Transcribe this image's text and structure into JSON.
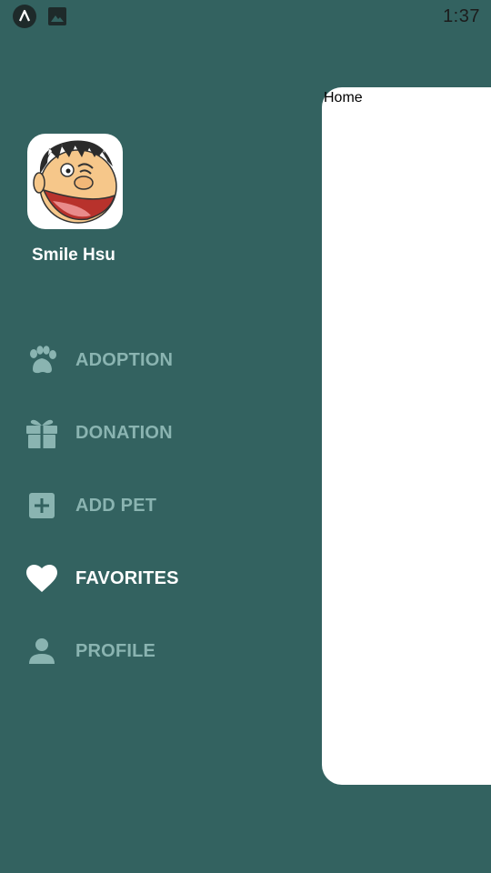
{
  "status_bar": {
    "time": "1:37",
    "icons": [
      "app-notification-icon",
      "image-notification-icon"
    ]
  },
  "drawer": {
    "user": {
      "name": "Smile Hsu",
      "avatar_icon": "cartoon-avatar"
    },
    "items": [
      {
        "label": "ADOPTION",
        "icon": "paw-icon",
        "active": false
      },
      {
        "label": "DONATION",
        "icon": "gift-icon",
        "active": false
      },
      {
        "label": "ADD PET",
        "icon": "add-box-icon",
        "active": false
      },
      {
        "label": "FAVORITES",
        "icon": "heart-icon",
        "active": true
      },
      {
        "label": "PROFILE",
        "icon": "person-icon",
        "active": false
      }
    ]
  },
  "main": {
    "title": "Home"
  },
  "colors": {
    "background": "#336260",
    "inactive_item": "#8ab4b1",
    "active_item": "#ffffff",
    "content_background": "#ffffff"
  }
}
